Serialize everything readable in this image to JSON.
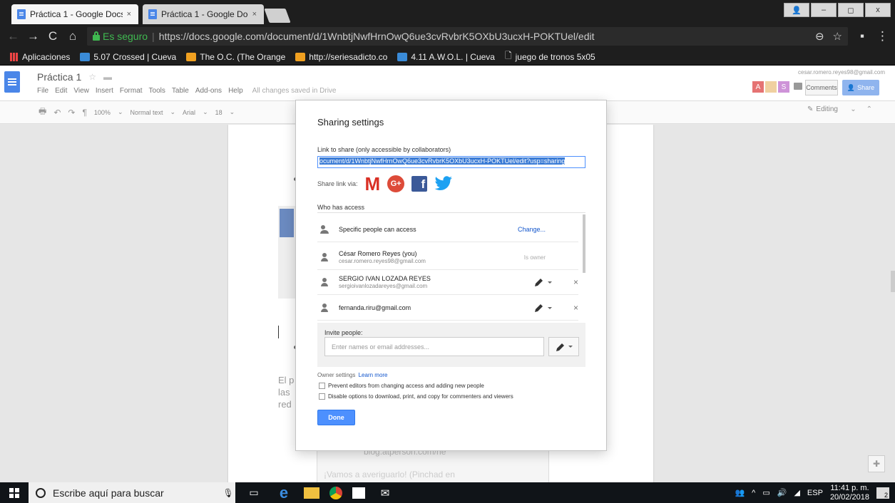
{
  "browser": {
    "tabs": [
      {
        "title": "Práctica 1 - Google Docs",
        "close": "×"
      },
      {
        "title": "Práctica 1 - Google Docs",
        "close": "×"
      }
    ],
    "window_controls": {
      "minimize": "–",
      "maximize": "◻",
      "close": "x"
    },
    "address": {
      "secure_label": "Es seguro",
      "separator": "|",
      "url": "https://docs.google.com/document/d/1WnbtjNwfHrnOwQ6ue3cvRvbrK5OXbU3ucxH-POKTUel/edit"
    },
    "bookmarks": [
      {
        "label": "Aplicaciones"
      },
      {
        "label": "5.07 Crossed | Cueva"
      },
      {
        "label": "The O.C. (The Orange"
      },
      {
        "label": "http://seriesadicto.co"
      },
      {
        "label": "4.11 A.W.O.L. | Cueva"
      },
      {
        "label": "juego de tronos 5x05"
      }
    ]
  },
  "docs": {
    "title": "Práctica 1",
    "menu": [
      "File",
      "Edit",
      "View",
      "Insert",
      "Format",
      "Tools",
      "Table",
      "Add-ons",
      "Help"
    ],
    "saved_status": "All changes saved in Drive",
    "account_email": "cesar.romero.reyes98@gmail.com",
    "collaborator_initials": [
      "A",
      "",
      "S"
    ],
    "comments_label": "Comments",
    "share_label": "Share",
    "toolbar": {
      "zoom": "100%",
      "style": "Normal text",
      "font": "Arial",
      "size": "18"
    },
    "mode_label": "Editing",
    "body_text": [
      "El p",
      "las",
      "red"
    ],
    "bg_url": "blog.atperson.com/he",
    "bg_line": "¡Vamos a averiguarlo! (Pinchad en"
  },
  "sharing_dialog": {
    "title": "Sharing settings",
    "link_label": "Link to share (only accessible by collaborators)",
    "link_value": "ocument/d/1WnbtjNwfHrnOwQ6ue3cvRvbrK5OXbU3ucxH-POKTUel/edit?usp=sharing",
    "share_via_label": "Share link via:",
    "gmail_letter": "M",
    "gplus_letter": "G+",
    "fb_letter": "f",
    "who_has_access_label": "Who has access",
    "access_mode": {
      "label": "Specific people can access",
      "change_link": "Change..."
    },
    "people": [
      {
        "name": "César Romero Reyes (you)",
        "email": "cesar.romero.reyes98@gmail.com",
        "role": "Is owner"
      },
      {
        "name": "SERGIO IVAN LOZADA REYES",
        "email": "sergioivanlozadareyes@gmail.com",
        "remove": "×"
      },
      {
        "name": "fernanda.riru@gmail.com",
        "email": "",
        "remove": "×"
      }
    ],
    "invite_label": "Invite people:",
    "invite_placeholder": "Enter names or email addresses...",
    "owner_settings_label": "Owner settings",
    "learn_more": "Learn more",
    "options": [
      {
        "label": "Prevent editors from changing access and adding new people",
        "checked": false
      },
      {
        "label": "Disable options to download, print, and copy for commenters and viewers",
        "checked": false
      }
    ],
    "done_label": "Done"
  },
  "taskbar": {
    "search_placeholder": "Escribe aquí para buscar",
    "language": "ESP",
    "time": "11:41 p. m.",
    "date": "20/02/2018",
    "notifications": "2"
  },
  "colors": {
    "accent_blue": "#4d90fe",
    "link_blue": "#1155cc",
    "secure_green": "#3fb950",
    "gmail_red": "#d93025",
    "gplus_red": "#dd4b39",
    "facebook_blue": "#3b5998",
    "twitter_blue": "#1da1f2"
  }
}
